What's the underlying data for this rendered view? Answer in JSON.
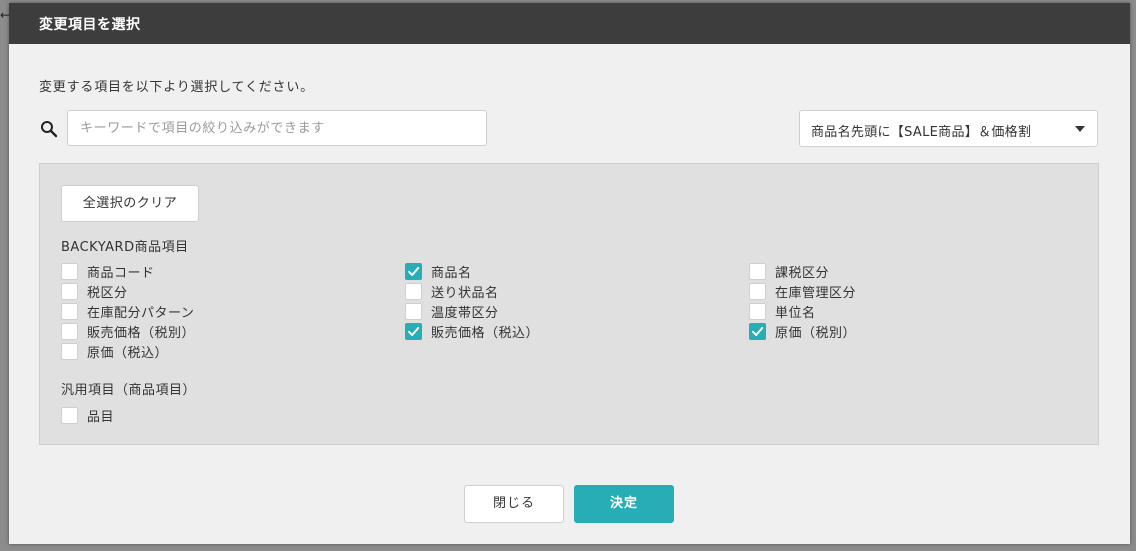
{
  "dialog": {
    "title": "変更項目を選択",
    "instruction": "変更する項目を以下より選択してください。"
  },
  "search": {
    "placeholder": "キーワードで項目の絞り込みができます",
    "value": ""
  },
  "preset": {
    "selected": "商品名先頭に【SALE商品】＆価格割"
  },
  "panel": {
    "clear_label": "全選択のクリア",
    "sections": [
      {
        "title": "BACKYARD商品項目",
        "items": [
          {
            "label": "商品コード",
            "checked": false
          },
          {
            "label": "商品名",
            "checked": true
          },
          {
            "label": "課税区分",
            "checked": false
          },
          {
            "label": "税区分",
            "checked": false
          },
          {
            "label": "送り状品名",
            "checked": false
          },
          {
            "label": "在庫管理区分",
            "checked": false
          },
          {
            "label": "在庫配分パターン",
            "checked": false
          },
          {
            "label": "温度帯区分",
            "checked": false
          },
          {
            "label": "単位名",
            "checked": false
          },
          {
            "label": "販売価格（税別）",
            "checked": false
          },
          {
            "label": "販売価格（税込）",
            "checked": true
          },
          {
            "label": "原価（税別）",
            "checked": true
          },
          {
            "label": "原価（税込）",
            "checked": false
          }
        ]
      },
      {
        "title": "汎用項目（商品項目）",
        "items": [
          {
            "label": "品目",
            "checked": false
          }
        ]
      }
    ]
  },
  "footer": {
    "close_label": "閉じる",
    "decide_label": "決定"
  },
  "colors": {
    "accent": "#26adb5",
    "header_bg": "#3d3d3d",
    "dialog_bg": "#f0f0f0",
    "panel_bg": "#e0e0e0"
  }
}
